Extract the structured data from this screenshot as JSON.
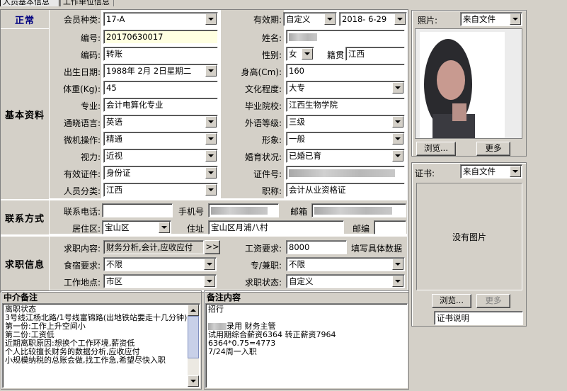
{
  "tabs": [
    "人员基本信息",
    "工作单位信息"
  ],
  "status": "正常",
  "sections": {
    "basic": "基本资料",
    "contact": "联系方式",
    "job": "求职信息",
    "agent_notes": "中介备注",
    "notes": "备注内容"
  },
  "basic": {
    "member_type": {
      "label": "会员种类:",
      "value": "17-A"
    },
    "validity": {
      "label": "有效期:",
      "mode": "自定义",
      "date": "2018- 6-29"
    },
    "number": {
      "label": "编号:",
      "value": "20170630017"
    },
    "name": {
      "label": "姓名:"
    },
    "code": {
      "label": "编码:",
      "value": "转账"
    },
    "gender": {
      "label": "性别:",
      "value": "女"
    },
    "hometown": {
      "label": "籍贯",
      "value": "江西"
    },
    "birth": {
      "label": "出生日期:",
      "value": "1988年 2月 2日星期二"
    },
    "height": {
      "label": "身高(Cm):",
      "value": "160"
    },
    "weight": {
      "label": "体重(Kg):",
      "value": "45"
    },
    "education": {
      "label": "文化程度:",
      "value": "大专"
    },
    "major": {
      "label": "专业:",
      "value": "会计电算化专业"
    },
    "school": {
      "label": "毕业院校:",
      "value": "江西生物学院"
    },
    "language": {
      "label": "通晓语言:",
      "value": "英语"
    },
    "fl_level": {
      "label": "外语等级:",
      "value": "三级"
    },
    "computer": {
      "label": "微机操作:",
      "value": "精通"
    },
    "appearance": {
      "label": "形象:",
      "value": "一般"
    },
    "vision": {
      "label": "视力:",
      "value": "近视"
    },
    "marital": {
      "label": "婚育状况:",
      "value": "已婚已育"
    },
    "id_type": {
      "label": "有效证件:",
      "value": "身份证"
    },
    "id_no": {
      "label": "证件号:"
    },
    "category": {
      "label": "人员分类:",
      "value": "江西"
    },
    "title": {
      "label": "职称:",
      "value": "会计从业资格证"
    }
  },
  "contact": {
    "phone": {
      "label": "联系电话:",
      "value": ""
    },
    "mobile": {
      "label": "手机号"
    },
    "email": {
      "label": "邮箱"
    },
    "district": {
      "label": "居住区:",
      "value": "宝山区"
    },
    "address": {
      "label": "住址",
      "value": "宝山区月浦八村"
    },
    "postcode": {
      "label": "邮编",
      "value": ""
    }
  },
  "job": {
    "content": {
      "label": "求职内容:",
      "value": "财务分析,会计,应收应付",
      "more": ">>"
    },
    "salary": {
      "label": "工资要求:",
      "value": "8000",
      "hint": "填写具体数据"
    },
    "board": {
      "label": "食宿要求:",
      "value": "不限"
    },
    "parttime": {
      "label": "专/兼职:",
      "value": "不限"
    },
    "location": {
      "label": "工作地点:",
      "value": "市区"
    },
    "state": {
      "label": "求职状态:",
      "value": "自定义"
    }
  },
  "photo": {
    "label": "照片:",
    "source": "来自文件",
    "browse": "浏览...",
    "more": "更多"
  },
  "cert": {
    "label": "证书:",
    "source": "来自文件",
    "empty": "没有图片",
    "browse": "浏览...",
    "more": "更多",
    "desc": "证书说明"
  },
  "agent_notes": [
    "离职状态",
    "3号线江杨北路/1号线富锦路(出地铁站要走十几分钟)",
    "第一份:工作上升空间小",
    "第二份:工资低",
    "近期离职原因:想换个工作环境,薪资低",
    "个人比较擅长财务的数据分析,应收应付",
    "小规模纳税的总账会做,找工作急,希望尽快入职"
  ],
  "notes": {
    "line1": "招行",
    "line2_suffix": "录用 财务主管",
    "line3": "试用期综合薪资6364 转正薪资7964",
    "line4": "6364*0.75=4773",
    "line5": "7/24周一入职"
  }
}
